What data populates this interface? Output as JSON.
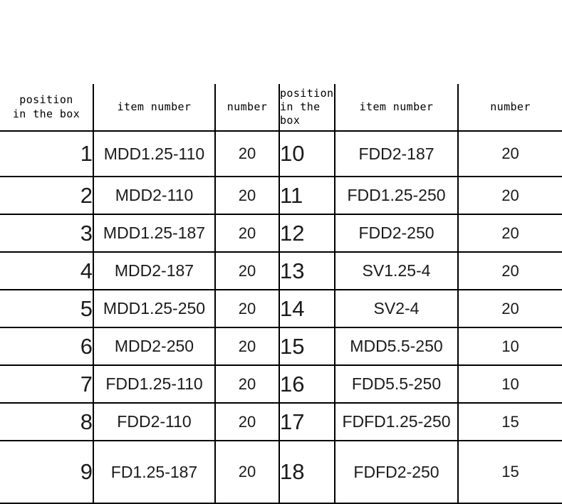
{
  "table": {
    "headers": {
      "position_left": "position\nin the box",
      "item_left": "item number",
      "number_left": "number",
      "position_right": "position\nin the\nbox",
      "item_right": "item number",
      "number_right": "number"
    },
    "rows": [
      {
        "pos_l": "1",
        "item_l": "MDD1.25-110",
        "num_l": "20",
        "pos_r": "10",
        "item_r": "FDD2-187",
        "num_r": "20"
      },
      {
        "pos_l": "2",
        "item_l": "MDD2-110",
        "num_l": "20",
        "pos_r": "11",
        "item_r": "FDD1.25-250",
        "num_r": "20"
      },
      {
        "pos_l": "3",
        "item_l": "MDD1.25-187",
        "num_l": "20",
        "pos_r": "12",
        "item_r": "FDD2-250",
        "num_r": "20"
      },
      {
        "pos_l": "4",
        "item_l": "MDD2-187",
        "num_l": "20",
        "pos_r": "13",
        "item_r": "SV1.25-4",
        "num_r": "20"
      },
      {
        "pos_l": "5",
        "item_l": "MDD1.25-250",
        "num_l": "20",
        "pos_r": "14",
        "item_r": "SV2-4",
        "num_r": "20"
      },
      {
        "pos_l": "6",
        "item_l": "MDD2-250",
        "num_l": "20",
        "pos_r": "15",
        "item_r": "MDD5.5-250",
        "num_r": "10"
      },
      {
        "pos_l": "7",
        "item_l": "FDD1.25-110",
        "num_l": "20",
        "pos_r": "16",
        "item_r": "FDD5.5-250",
        "num_r": "10"
      },
      {
        "pos_l": "8",
        "item_l": "FDD2-110",
        "num_l": "20",
        "pos_r": "17",
        "item_r": "FDFD1.25-250",
        "num_r": "15"
      },
      {
        "pos_l": "9",
        "item_l": "FD1.25-187",
        "num_l": "20",
        "pos_r": "18",
        "item_r": "FDFD2-250",
        "num_r": "15"
      }
    ]
  },
  "colors": {
    "background": "#ffffff",
    "text": "#1a1a1a",
    "rule": "#000000"
  }
}
